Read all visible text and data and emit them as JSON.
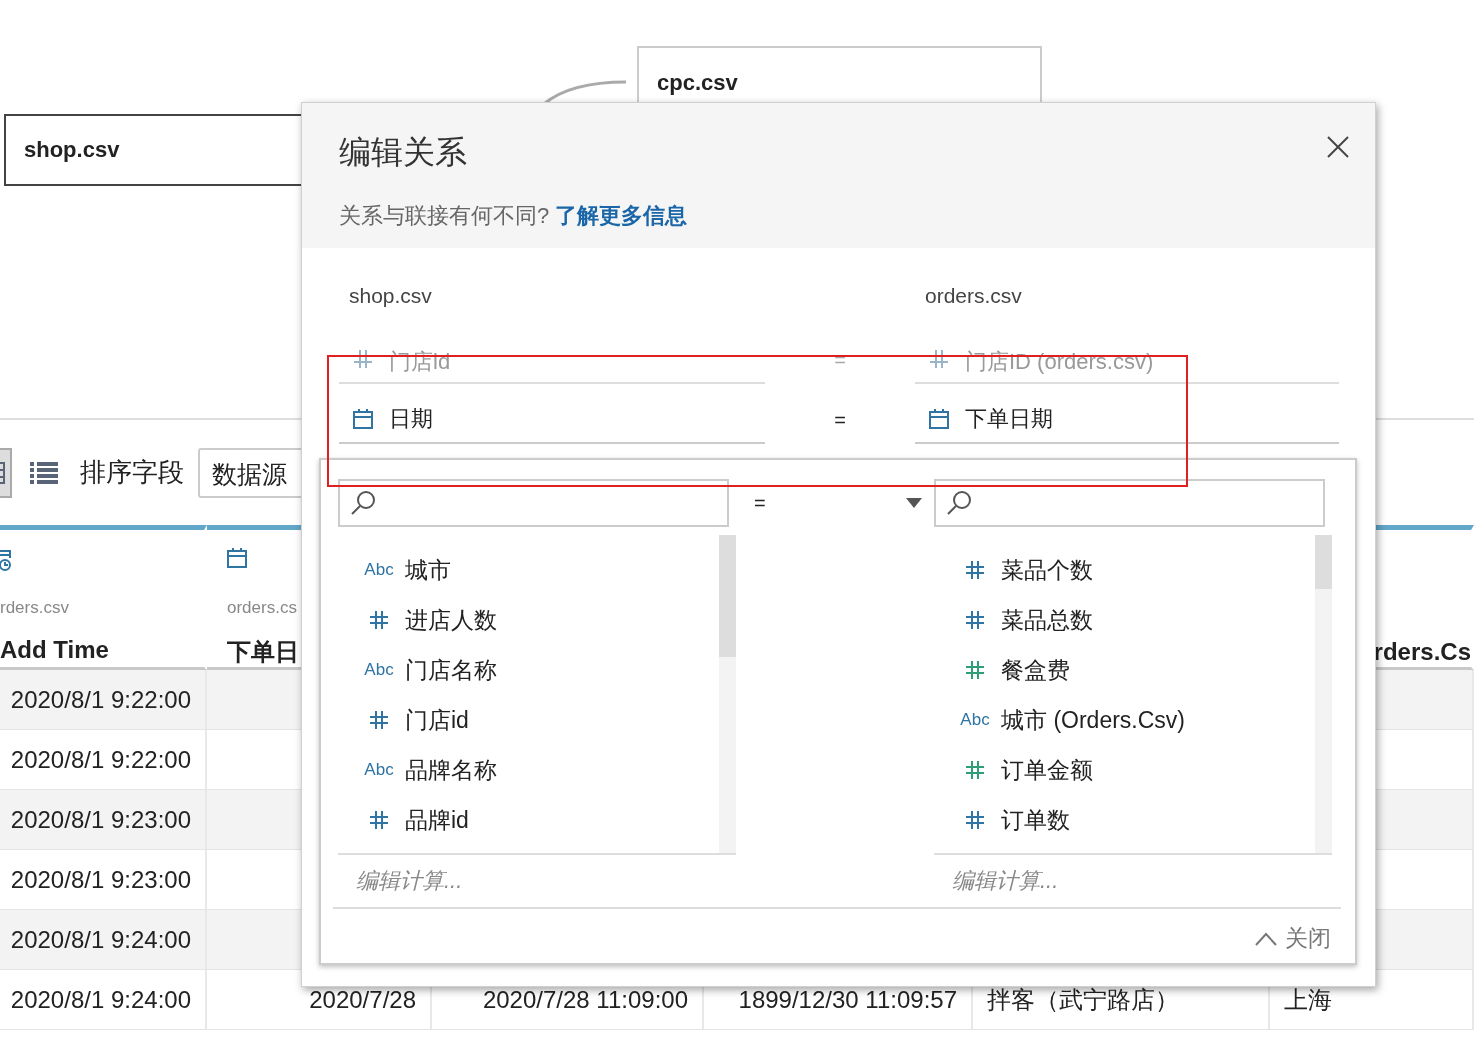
{
  "canvas": {
    "nodes": [
      {
        "label": "cpc.csv"
      },
      {
        "label": "shop.csv"
      }
    ]
  },
  "toolbar": {
    "views": [
      {
        "kind": "grid",
        "selected": true
      },
      {
        "kind": "list",
        "selected": false
      }
    ],
    "sort_label": "排序字段",
    "sort_value": "数据源"
  },
  "table": {
    "columns": [
      {
        "kind": "datetime",
        "source": "rders.csv",
        "name": "Add Time"
      },
      {
        "kind": "date",
        "source": "orders.cs",
        "name": "下单日"
      },
      {
        "name": "rders.Cs"
      }
    ],
    "rows": [
      {
        "cells": [
          "2020/8/1 9:22:00"
        ]
      },
      {
        "cells": [
          "2020/8/1 9:22:00"
        ]
      },
      {
        "cells": [
          "2020/8/1 9:23:00"
        ]
      },
      {
        "cells": [
          "2020/8/1 9:23:00"
        ]
      },
      {
        "cells": [
          "2020/8/1 9:24:00"
        ]
      },
      {
        "cells": [
          "2020/8/1 9:24:00",
          "2020/7/28",
          "2020/7/28 11:09:00",
          "1899/12/30 11:09:57",
          "拌客（武宁路店）",
          "上海"
        ]
      }
    ]
  },
  "dialog": {
    "title": "编辑关系",
    "subtitle": "关系与联接有何不同?",
    "link": "了解更多信息",
    "left_table": "shop.csv",
    "right_table": "orders.csv",
    "relations": [
      {
        "selected": false,
        "left": {
          "kind": "number",
          "name": "门店id"
        },
        "operator": "=",
        "right": {
          "kind": "number",
          "name": "门店ID (orders.csv)"
        }
      },
      {
        "selected": true,
        "left": {
          "kind": "date",
          "name": "日期"
        },
        "operator": "=",
        "right": {
          "kind": "date",
          "name": "下单日期"
        }
      }
    ],
    "editor": {
      "operator": "=",
      "left_fields": [
        {
          "kind": "string",
          "badge": "Abc",
          "name": "城市",
          "color": "#2f74a3"
        },
        {
          "kind": "number",
          "name": "进店人数",
          "color": "#2f74a3"
        },
        {
          "kind": "string",
          "badge": "Abc",
          "name": "门店名称",
          "color": "#2f74a3"
        },
        {
          "kind": "number",
          "name": "门店id",
          "color": "#2f74a3"
        },
        {
          "kind": "string",
          "badge": "Abc",
          "name": "品牌名称",
          "color": "#2f74a3"
        },
        {
          "kind": "number",
          "name": "品牌id",
          "color": "#2f74a3"
        }
      ],
      "right_fields": [
        {
          "kind": "number",
          "name": "菜品个数",
          "color": "#2f74a3"
        },
        {
          "kind": "number",
          "name": "菜品总数",
          "color": "#2f74a3"
        },
        {
          "kind": "number",
          "name": "餐盒费",
          "color": "#2e9e78"
        },
        {
          "kind": "string",
          "badge": "Abc",
          "name": "城市 (Orders.Csv)",
          "color": "#2f74a3"
        },
        {
          "kind": "number",
          "name": "订单金额",
          "color": "#2e9e78"
        },
        {
          "kind": "number",
          "name": "订单数",
          "color": "#2f74a3"
        }
      ],
      "left_calc": "编辑计算...",
      "right_calc": "编辑计算...",
      "collapse": "关闭"
    }
  }
}
